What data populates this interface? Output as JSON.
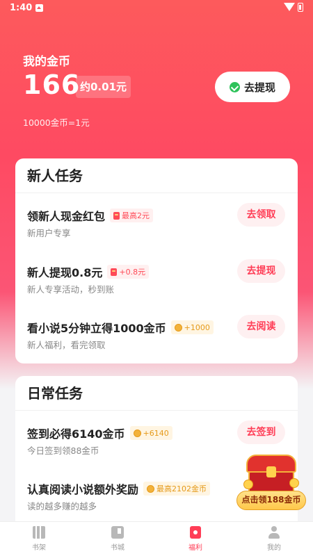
{
  "status_bar": {
    "time": "1:40"
  },
  "wallet": {
    "label": "我的金币",
    "coins": "166",
    "approx": "约0.01元",
    "rate": "10000金币=1元",
    "withdraw_label": "去提现"
  },
  "new_tasks": {
    "title": "新人任务",
    "items": [
      {
        "title": "领新人现金红包",
        "tag": "最高2元",
        "tag_icon": "red-envelope-icon",
        "subtitle": "新用户专享",
        "button": "去领取"
      },
      {
        "title": "新人提现0.8元",
        "tag": "+0.8元",
        "tag_icon": "red-envelope-icon",
        "subtitle": "新人专享活动，秒到账",
        "button": "去提现"
      },
      {
        "title": "看小说5分钟立得1000金币",
        "tag": "+1000",
        "tag_icon": "coin-icon",
        "subtitle": "新人福利，看完领取",
        "button": "去阅读"
      }
    ]
  },
  "daily_tasks": {
    "title": "日常任务",
    "items": [
      {
        "title": "签到必得6140金币",
        "tag": "+6140",
        "tag_icon": "coin-icon",
        "subtitle": "今日签到领88金币",
        "button": "去签到"
      },
      {
        "title": "认真阅读小说额外奖励",
        "tag": "最高2102金币",
        "tag_icon": "coin-icon",
        "subtitle": "读的越多赚的越多",
        "button": ""
      }
    ]
  },
  "promo": {
    "label": "点击领188金币",
    "icon": "treasure-chest-icon"
  },
  "tabbar": {
    "items": [
      {
        "label": "书架",
        "icon": "bookshelf-icon"
      },
      {
        "label": "书城",
        "icon": "bookstore-icon"
      },
      {
        "label": "福利",
        "icon": "welfare-icon"
      },
      {
        "label": "我的",
        "icon": "profile-icon"
      }
    ],
    "active": "福利"
  },
  "colors": {
    "accent": "#ff3d56",
    "header": "#fe4a62",
    "gold": "#e59a1a"
  }
}
